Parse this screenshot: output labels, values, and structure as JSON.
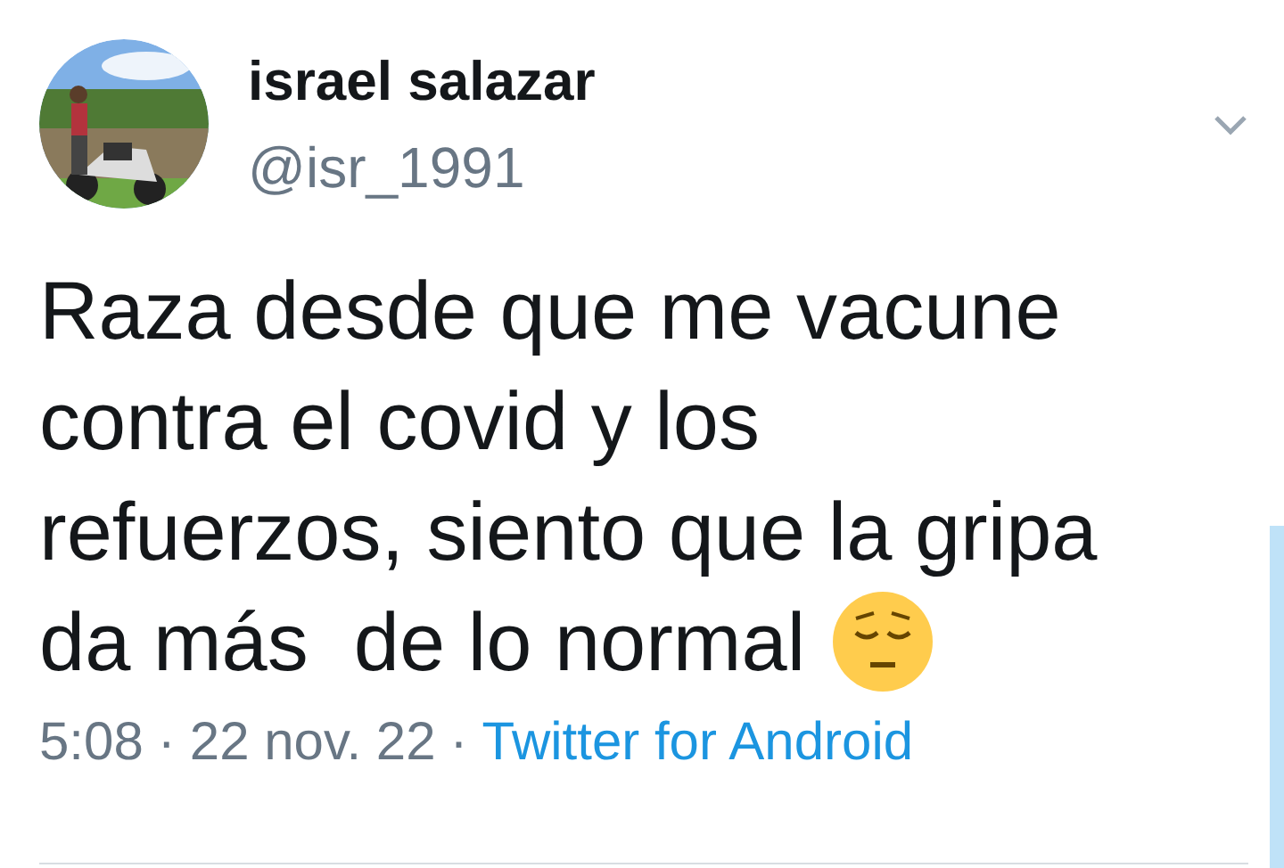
{
  "author": {
    "name": "israel salazar",
    "handle": "@isr_1991"
  },
  "tweet": {
    "lines": [
      "Raza desde que me vacune",
      "contra el covid y los",
      "refuerzos, siento que la gripa",
      "da más  de lo normal"
    ]
  },
  "meta": {
    "time": "5:08",
    "separator_1": "·",
    "date": "22 nov. 22",
    "separator_2": "·",
    "source": "Twitter for Android"
  }
}
